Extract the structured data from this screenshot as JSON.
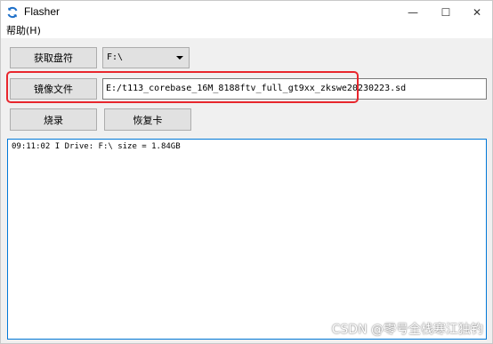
{
  "window": {
    "title": "Flasher",
    "controls": {
      "minimize": "—",
      "maximize": "☐",
      "close": "✕"
    }
  },
  "menu": {
    "help": "帮助(H)"
  },
  "buttons": {
    "get_drive": "获取盘符",
    "image_file": "镜像文件",
    "burn": "烧录",
    "restore_card": "恢复卡"
  },
  "drive_select": {
    "value": "F:\\"
  },
  "image_path": {
    "value": "E:/t113_corebase_16M_8188ftv_full_gt9xx_zkswe20230223.sd"
  },
  "log": {
    "lines": [
      "09:11:02 I Drive: F:\\ size = 1.84GB"
    ]
  },
  "watermark": "CSDN @零号全栈寒江独钓",
  "colors": {
    "highlight": "#e8262d",
    "log_border": "#0078d7",
    "button_bg": "#e1e1e1"
  },
  "icons": {
    "app": "refresh-arrows-icon"
  }
}
